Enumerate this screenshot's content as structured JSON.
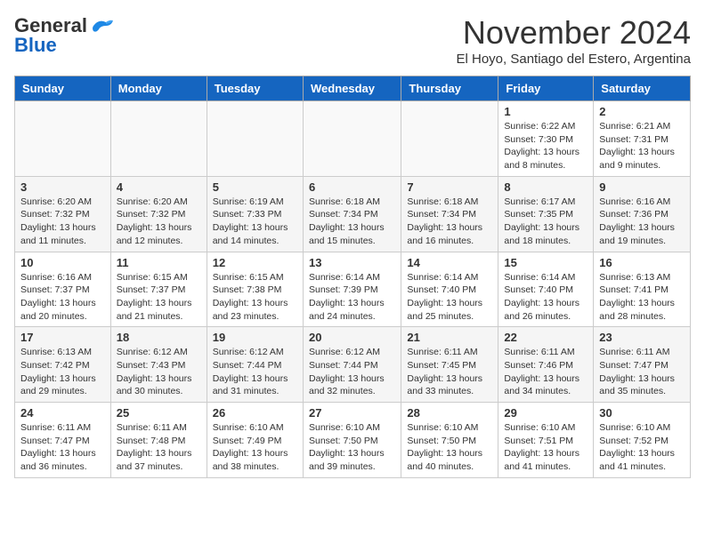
{
  "header": {
    "logo_general": "General",
    "logo_blue": "Blue",
    "month_title": "November 2024",
    "subtitle": "El Hoyo, Santiago del Estero, Argentina"
  },
  "weekdays": [
    "Sunday",
    "Monday",
    "Tuesday",
    "Wednesday",
    "Thursday",
    "Friday",
    "Saturday"
  ],
  "weeks": [
    [
      {
        "day": "",
        "info": ""
      },
      {
        "day": "",
        "info": ""
      },
      {
        "day": "",
        "info": ""
      },
      {
        "day": "",
        "info": ""
      },
      {
        "day": "",
        "info": ""
      },
      {
        "day": "1",
        "info": "Sunrise: 6:22 AM\nSunset: 7:30 PM\nDaylight: 13 hours\nand 8 minutes."
      },
      {
        "day": "2",
        "info": "Sunrise: 6:21 AM\nSunset: 7:31 PM\nDaylight: 13 hours\nand 9 minutes."
      }
    ],
    [
      {
        "day": "3",
        "info": "Sunrise: 6:20 AM\nSunset: 7:32 PM\nDaylight: 13 hours\nand 11 minutes."
      },
      {
        "day": "4",
        "info": "Sunrise: 6:20 AM\nSunset: 7:32 PM\nDaylight: 13 hours\nand 12 minutes."
      },
      {
        "day": "5",
        "info": "Sunrise: 6:19 AM\nSunset: 7:33 PM\nDaylight: 13 hours\nand 14 minutes."
      },
      {
        "day": "6",
        "info": "Sunrise: 6:18 AM\nSunset: 7:34 PM\nDaylight: 13 hours\nand 15 minutes."
      },
      {
        "day": "7",
        "info": "Sunrise: 6:18 AM\nSunset: 7:34 PM\nDaylight: 13 hours\nand 16 minutes."
      },
      {
        "day": "8",
        "info": "Sunrise: 6:17 AM\nSunset: 7:35 PM\nDaylight: 13 hours\nand 18 minutes."
      },
      {
        "day": "9",
        "info": "Sunrise: 6:16 AM\nSunset: 7:36 PM\nDaylight: 13 hours\nand 19 minutes."
      }
    ],
    [
      {
        "day": "10",
        "info": "Sunrise: 6:16 AM\nSunset: 7:37 PM\nDaylight: 13 hours\nand 20 minutes."
      },
      {
        "day": "11",
        "info": "Sunrise: 6:15 AM\nSunset: 7:37 PM\nDaylight: 13 hours\nand 21 minutes."
      },
      {
        "day": "12",
        "info": "Sunrise: 6:15 AM\nSunset: 7:38 PM\nDaylight: 13 hours\nand 23 minutes."
      },
      {
        "day": "13",
        "info": "Sunrise: 6:14 AM\nSunset: 7:39 PM\nDaylight: 13 hours\nand 24 minutes."
      },
      {
        "day": "14",
        "info": "Sunrise: 6:14 AM\nSunset: 7:40 PM\nDaylight: 13 hours\nand 25 minutes."
      },
      {
        "day": "15",
        "info": "Sunrise: 6:14 AM\nSunset: 7:40 PM\nDaylight: 13 hours\nand 26 minutes."
      },
      {
        "day": "16",
        "info": "Sunrise: 6:13 AM\nSunset: 7:41 PM\nDaylight: 13 hours\nand 28 minutes."
      }
    ],
    [
      {
        "day": "17",
        "info": "Sunrise: 6:13 AM\nSunset: 7:42 PM\nDaylight: 13 hours\nand 29 minutes."
      },
      {
        "day": "18",
        "info": "Sunrise: 6:12 AM\nSunset: 7:43 PM\nDaylight: 13 hours\nand 30 minutes."
      },
      {
        "day": "19",
        "info": "Sunrise: 6:12 AM\nSunset: 7:44 PM\nDaylight: 13 hours\nand 31 minutes."
      },
      {
        "day": "20",
        "info": "Sunrise: 6:12 AM\nSunset: 7:44 PM\nDaylight: 13 hours\nand 32 minutes."
      },
      {
        "day": "21",
        "info": "Sunrise: 6:11 AM\nSunset: 7:45 PM\nDaylight: 13 hours\nand 33 minutes."
      },
      {
        "day": "22",
        "info": "Sunrise: 6:11 AM\nSunset: 7:46 PM\nDaylight: 13 hours\nand 34 minutes."
      },
      {
        "day": "23",
        "info": "Sunrise: 6:11 AM\nSunset: 7:47 PM\nDaylight: 13 hours\nand 35 minutes."
      }
    ],
    [
      {
        "day": "24",
        "info": "Sunrise: 6:11 AM\nSunset: 7:47 PM\nDaylight: 13 hours\nand 36 minutes."
      },
      {
        "day": "25",
        "info": "Sunrise: 6:11 AM\nSunset: 7:48 PM\nDaylight: 13 hours\nand 37 minutes."
      },
      {
        "day": "26",
        "info": "Sunrise: 6:10 AM\nSunset: 7:49 PM\nDaylight: 13 hours\nand 38 minutes."
      },
      {
        "day": "27",
        "info": "Sunrise: 6:10 AM\nSunset: 7:50 PM\nDaylight: 13 hours\nand 39 minutes."
      },
      {
        "day": "28",
        "info": "Sunrise: 6:10 AM\nSunset: 7:50 PM\nDaylight: 13 hours\nand 40 minutes."
      },
      {
        "day": "29",
        "info": "Sunrise: 6:10 AM\nSunset: 7:51 PM\nDaylight: 13 hours\nand 41 minutes."
      },
      {
        "day": "30",
        "info": "Sunrise: 6:10 AM\nSunset: 7:52 PM\nDaylight: 13 hours\nand 41 minutes."
      }
    ]
  ]
}
